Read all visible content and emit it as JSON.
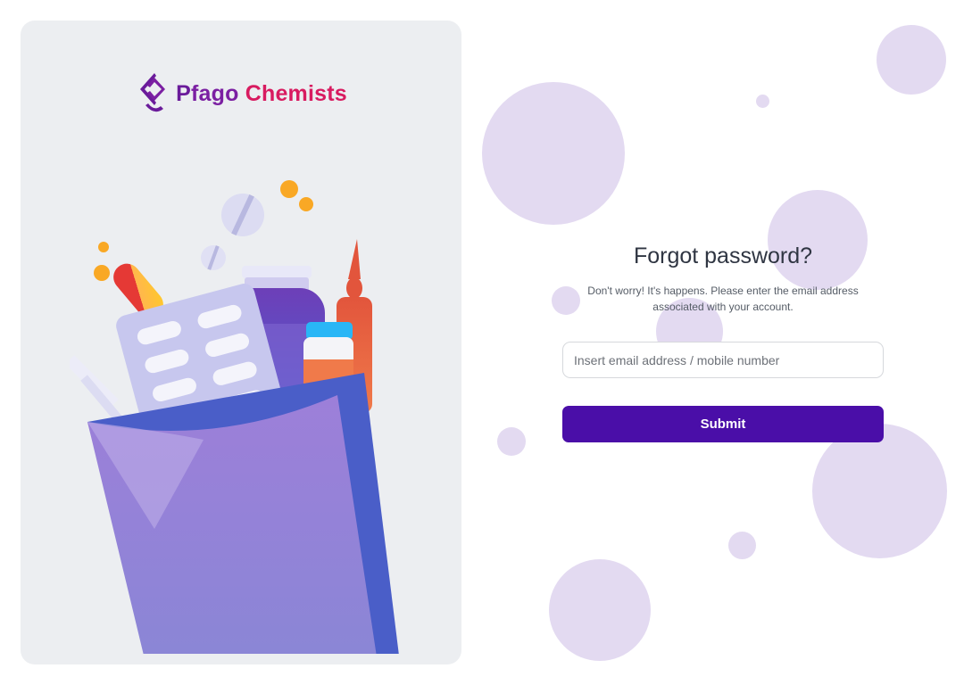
{
  "brand": {
    "name_p": "P",
    "name_rest": "fago ",
    "name_chem": "Chemists",
    "colors": {
      "purple": "#7b1fa2",
      "pink": "#d81b60"
    }
  },
  "form": {
    "title": "Forgot password?",
    "subtitle": "Don't worry! It's happens. Please enter the email address associated with your account.",
    "email_placeholder": "Insert email address / mobile number",
    "email_value": "",
    "submit_label": "Submit"
  },
  "colors": {
    "accent": "#4a0ea8",
    "bubble": "#e3daf1",
    "panel_bg": "#eceef1"
  },
  "illustration": {
    "icon": "pharmacy-bag-illustration"
  }
}
